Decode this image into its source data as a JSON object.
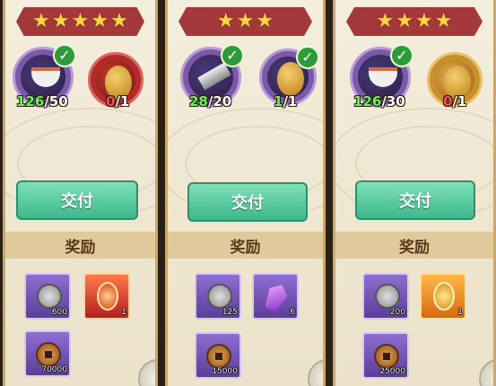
{
  "cards": [
    {
      "stars": 5,
      "requirements": [
        {
          "icon": "food-bowl-icon",
          "have": "126",
          "need": "50",
          "complete": true
        },
        {
          "icon": "golden-egg-icon",
          "have": "0",
          "need": "1",
          "complete": false
        }
      ],
      "deliver_label": "交付",
      "reward_title": "奖励",
      "rewards": [
        {
          "icon": "paw-token-icon",
          "qty": "600"
        },
        {
          "icon": "red-badge-icon",
          "qty": "1"
        },
        {
          "icon": "copper-coin-icon",
          "qty": "70000"
        }
      ]
    },
    {
      "stars": 3,
      "requirements": [
        {
          "icon": "iron-bar-icon",
          "have": "28",
          "need": "20",
          "complete": true
        },
        {
          "icon": "golden-egg-icon",
          "have": "1",
          "need": "1",
          "complete": true
        }
      ],
      "deliver_label": "交付",
      "reward_title": "奖励",
      "rewards": [
        {
          "icon": "paw-token-icon",
          "qty": "125"
        },
        {
          "icon": "purple-crystal-icon",
          "qty": "6"
        },
        {
          "icon": "copper-coin-icon",
          "qty": "15000"
        }
      ]
    },
    {
      "stars": 4,
      "requirements": [
        {
          "icon": "food-bowl-icon",
          "have": "126",
          "need": "30",
          "complete": true
        },
        {
          "icon": "golden-egg-icon",
          "have": "0",
          "need": "1",
          "complete": false
        }
      ],
      "deliver_label": "交付",
      "reward_title": "奖励",
      "rewards": [
        {
          "icon": "paw-token-icon",
          "qty": "200"
        },
        {
          "icon": "gold-badge-icon",
          "qty": "1"
        },
        {
          "icon": "copper-coin-icon",
          "qty": "25000"
        }
      ]
    }
  ],
  "colors": {
    "complete": "#6cf35a",
    "incomplete": "#ff4d4d",
    "button": "#3fb88b",
    "banner": "#a3393a"
  }
}
